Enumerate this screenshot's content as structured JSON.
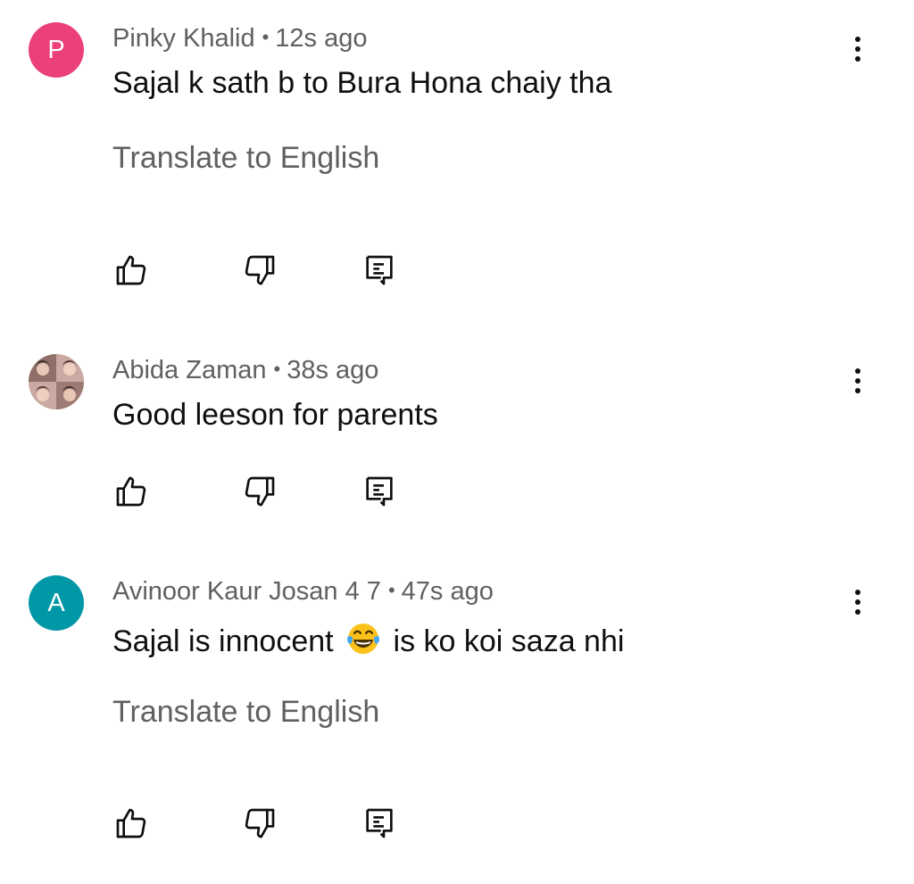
{
  "comments": [
    {
      "avatar_letter": "P",
      "avatar_color": "#ec407a",
      "author": "Pinky Khalid",
      "time": "12s ago",
      "text": "Sajal k sath b to Bura Hona chaiy tha",
      "translate_label": "Translate to English",
      "icons": [
        "like-icon",
        "dislike-icon",
        "reply-icon",
        "more-vert-icon"
      ]
    },
    {
      "avatar_type": "photo",
      "author": "Abida Zaman",
      "time": "38s ago",
      "text": "Good leeson for parents",
      "icons": [
        "like-icon",
        "dislike-icon",
        "reply-icon",
        "more-vert-icon"
      ]
    },
    {
      "avatar_letter": "A",
      "avatar_color": "#0097a7",
      "author": "Avinoor Kaur Josan 4 7",
      "time": "47s ago",
      "text_before_emoji": "Sajal is innocent",
      "emoji": "face-with-tears-of-joy",
      "text_after_emoji": "is ko koi saza nhi",
      "translate_label": "Translate to English",
      "icons": [
        "like-icon",
        "dislike-icon",
        "reply-icon",
        "more-vert-icon"
      ]
    }
  ],
  "separator": "•"
}
